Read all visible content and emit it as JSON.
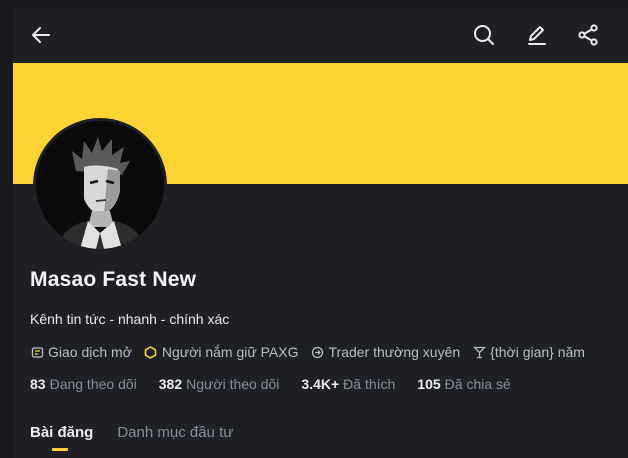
{
  "profile": {
    "name": "Masao Fast New",
    "bio": "Kênh tin tức - nhanh - chính xác"
  },
  "badges": [
    {
      "icon": "trade-icon",
      "label": "Giao dịch mở"
    },
    {
      "icon": "paxg-coin-icon",
      "label": "Người nắm giữ PAXG"
    },
    {
      "icon": "refresh-icon",
      "label": "Trader thường xuyên"
    },
    {
      "icon": "cocktail-icon",
      "label": "{thời gian} năm"
    }
  ],
  "stats": [
    {
      "value": "83",
      "label": "Đang theo dõi"
    },
    {
      "value": "382",
      "label": "Người theo dõi"
    },
    {
      "value": "3.4K+",
      "label": "Đã thích"
    },
    {
      "value": "105",
      "label": "Đã chia sẻ"
    }
  ],
  "tabs": [
    {
      "label": "Bài đăng",
      "active": true
    },
    {
      "label": "Danh mục đầu tư",
      "active": false
    }
  ],
  "colors": {
    "accent": "#fcd535",
    "background": "#1e2026",
    "muted": "#848e9c"
  }
}
